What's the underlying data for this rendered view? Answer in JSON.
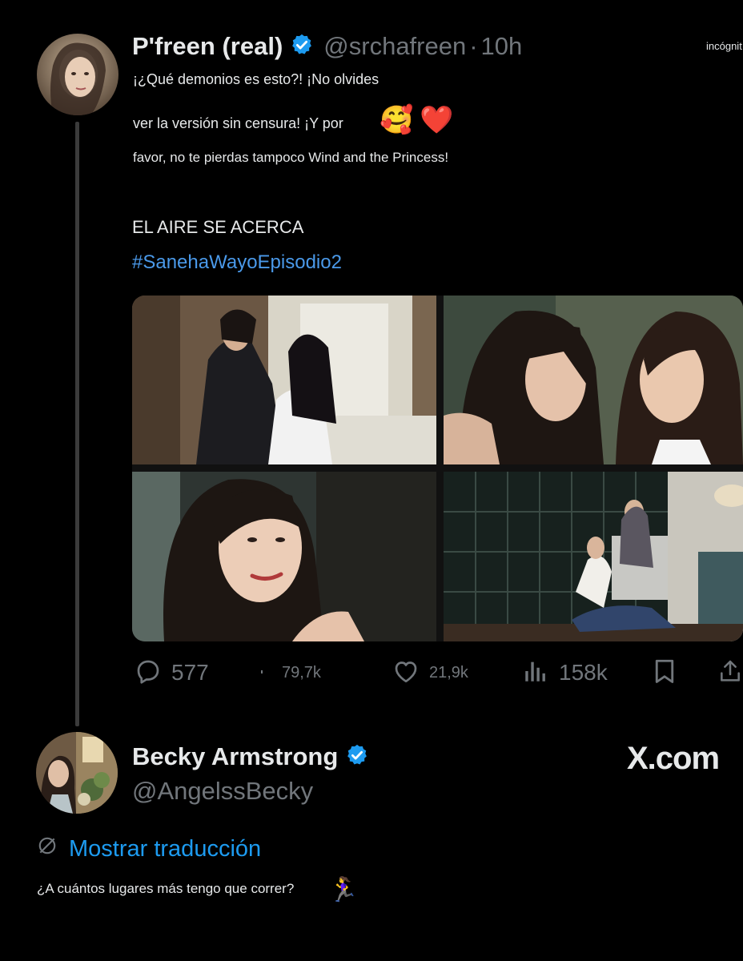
{
  "corner_label": "incógnit",
  "tweet": {
    "author_name": "P'freen (real)",
    "handle": "@srchafreen",
    "separator": "·",
    "time": "10h",
    "lines": [
      "¡¿Qué demonios es esto?! ¡No olvides",
      "ver la versión sin censura! ¡Y por",
      "favor, no te pierdas tampoco Wind and the Princess!"
    ],
    "emojis": [
      "🥰",
      "❤️"
    ],
    "headline": "EL AIRE SE ACERCA",
    "hashtag": "#SanehaWayoEpisodio2",
    "stats": {
      "replies": "577",
      "reposts": "79,7k",
      "likes": "21,9k",
      "views": "158k"
    }
  },
  "reply": {
    "author_name": "Becky Armstrong",
    "handle": "@AngelssBecky",
    "translate_label": "Mostrar traducción",
    "text": "¿A cuántos lugares más tengo que correr?",
    "emoji": "🏃‍♀️"
  },
  "watermark": "X.com",
  "icons": {
    "verified": "verified-badge-icon",
    "reply": "reply-icon",
    "repost": "repost-icon",
    "like": "heart-icon",
    "views": "views-icon",
    "bookmark": "bookmark-icon",
    "share": "share-icon",
    "translate": "translate-icon"
  },
  "colors": {
    "background": "#000000",
    "text": "#e7e9ea",
    "muted": "#71767b",
    "link": "#1d9bf0",
    "hashtag": "#4a99e9",
    "verified": "#1d9bf0"
  }
}
